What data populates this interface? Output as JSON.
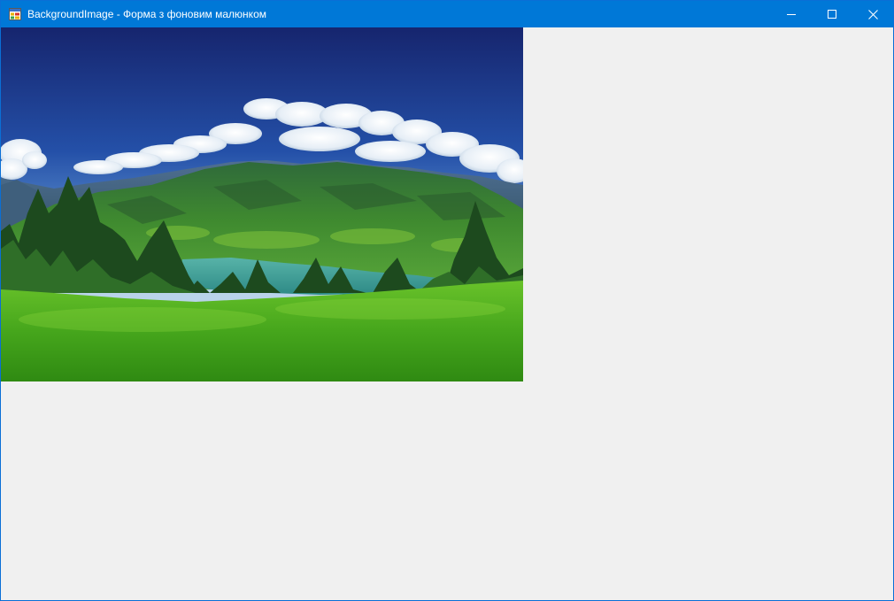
{
  "window": {
    "title": "BackgroundImage - Форма з фоновим малюнком",
    "app_icon": "form-app-icon",
    "controls": {
      "minimize_icon": "minimize-icon",
      "maximize_icon": "maximize-icon",
      "close_icon": "close-icon"
    }
  },
  "colors": {
    "titlebar": "#0078d7",
    "client_background": "#f0f0f0",
    "window_border": "#0a6fd6"
  },
  "background_image": {
    "subject": "mountain-lake-landscape"
  }
}
